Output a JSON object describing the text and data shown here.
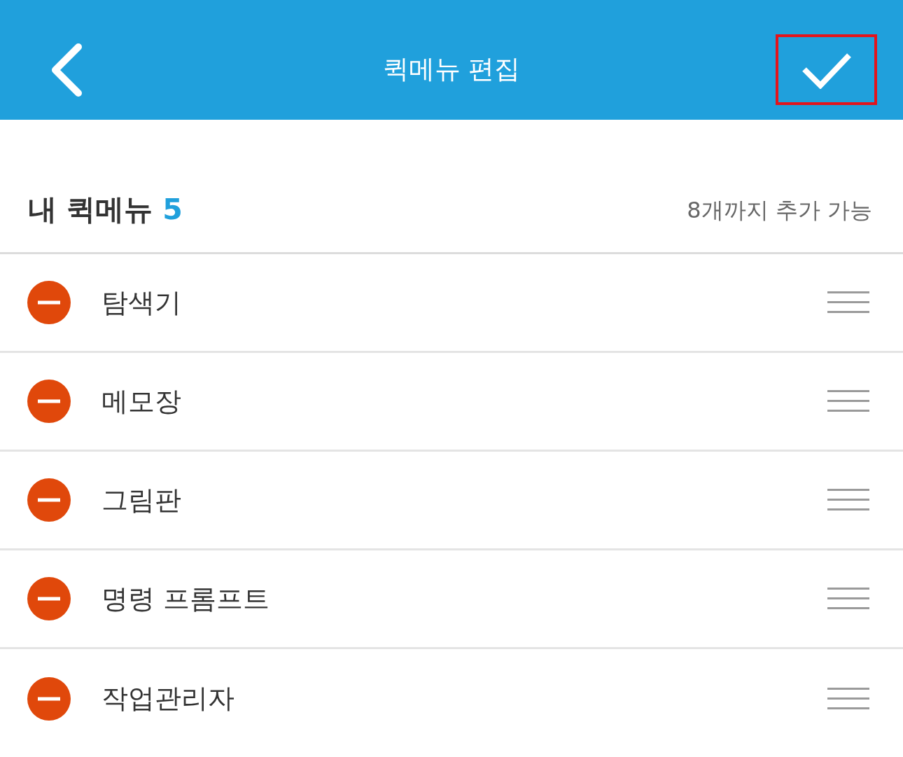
{
  "header": {
    "title": "퀵메뉴 편집",
    "confirm_button": {
      "highlighted": true
    }
  },
  "section": {
    "title": "내 퀵메뉴",
    "count": "5",
    "limit_note": "8개까지 추가 가능"
  },
  "items": [
    {
      "label": "탐색기"
    },
    {
      "label": "메모장"
    },
    {
      "label": "그림판"
    },
    {
      "label": "명령 프롬프트"
    },
    {
      "label": "작업관리자"
    }
  ]
}
